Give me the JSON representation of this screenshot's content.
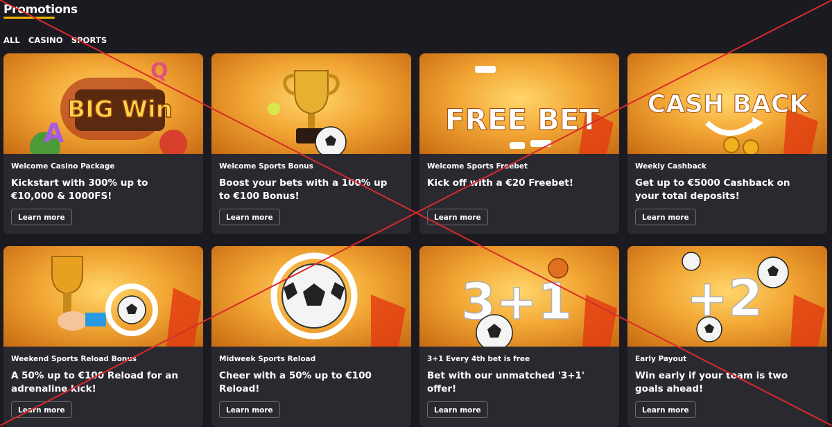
{
  "page": {
    "title": "Promotions"
  },
  "filters": [
    "ALL",
    "CASINO",
    "SPORTS"
  ],
  "cards": [
    {
      "category": "Welcome Casino Package",
      "description": "Kickstart with 300% up to €10,000 & 1000FS!",
      "button": "Learn more",
      "banner_text": "BIG Win"
    },
    {
      "category": "Welcome Sports Bonus",
      "description": "Boost your bets with a 100% up to €100 Bonus!",
      "button": "Learn more",
      "banner_text": ""
    },
    {
      "category": "Welcome Sports Freebet",
      "description": "Kick off with a €20 Freebet!",
      "button": "Learn more",
      "banner_text": "FREE BET"
    },
    {
      "category": "Weekly Cashback",
      "description": "Get up to €5000 Cashback on your total deposits!",
      "button": "Learn more",
      "banner_text": "CASH BACK"
    },
    {
      "category": "Weekend Sports Reload Bonus",
      "description": "A 50% up to €100 Reload for an adrenaline kick!",
      "button": "Learn more",
      "banner_text": ""
    },
    {
      "category": "Midweek Sports Reload",
      "description": "Cheer with a 50% up to €100 Reload!",
      "button": "Learn more",
      "banner_text": ""
    },
    {
      "category": "3+1 Every 4th bet is free",
      "description": "Bet with our unmatched '3+1' offer!",
      "button": "Learn more",
      "banner_text": "3+1"
    },
    {
      "category": "Early Payout",
      "description": "Win early if your team is two goals ahead!",
      "button": "Learn more",
      "banner_text": "+2"
    }
  ],
  "colors": {
    "background": "#1b1a20",
    "card": "#2a2930",
    "accent": "#f5b400",
    "overlay_cross": "#d92b2b"
  }
}
